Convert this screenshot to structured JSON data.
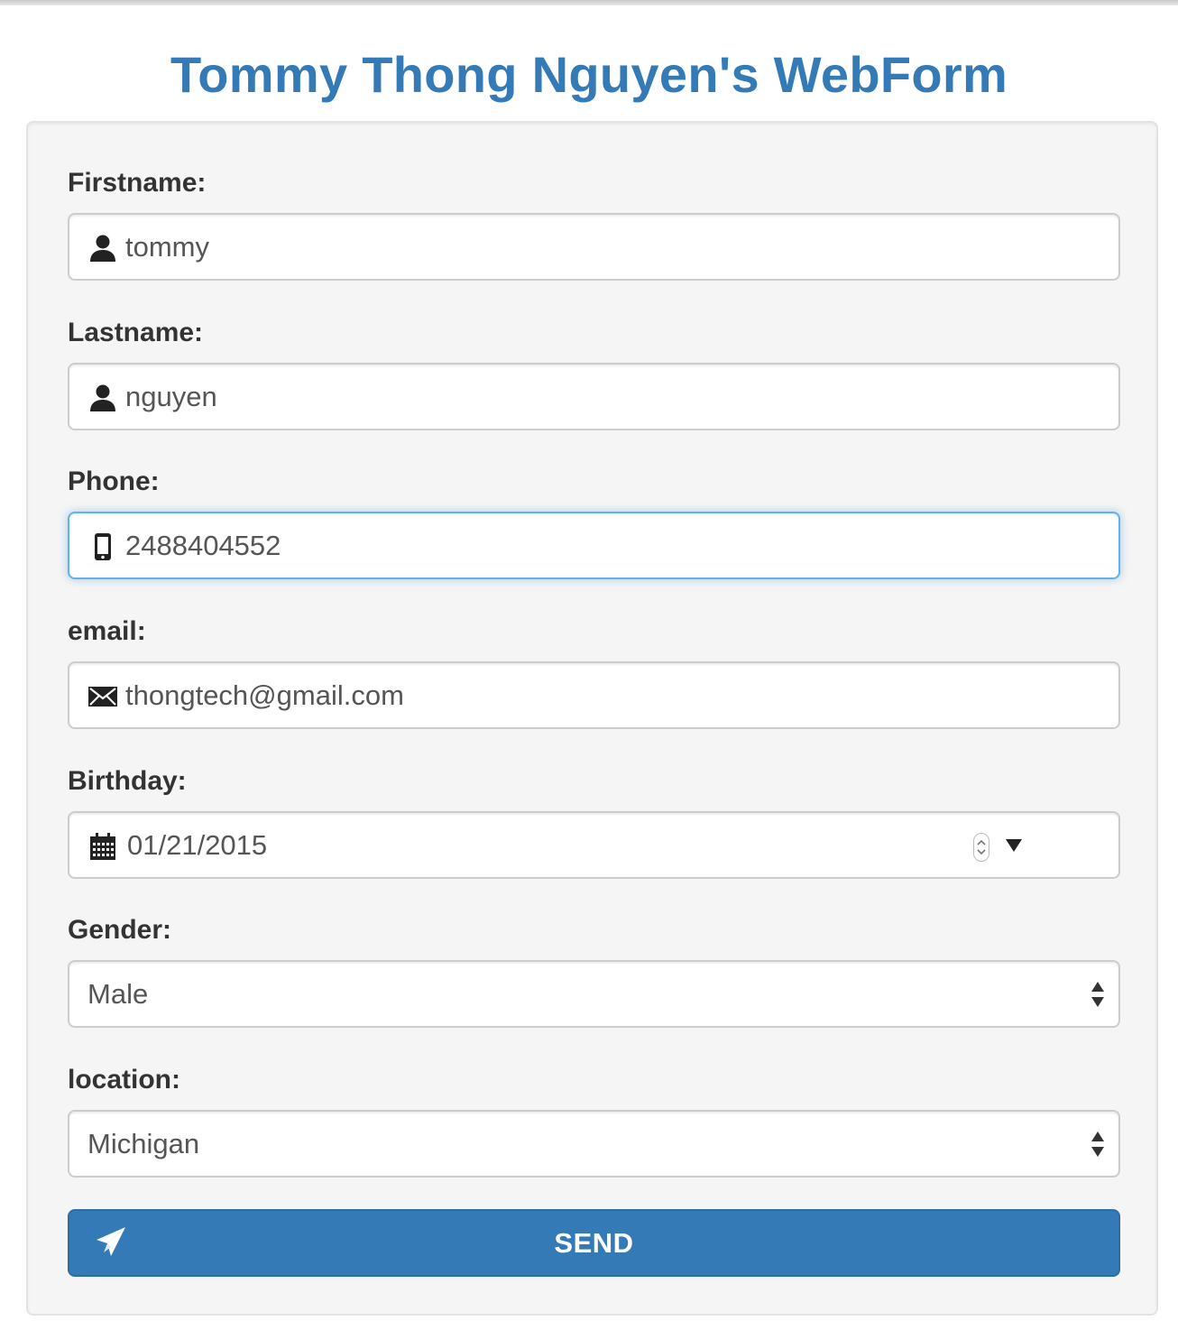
{
  "page": {
    "title": "Tommy Thong Nguyen's WebForm"
  },
  "colors": {
    "accent": "#337ab7",
    "panel_background": "#f5f5f5",
    "focus_border": "#66afe9"
  },
  "form": {
    "firstname": {
      "label": "Firstname:",
      "value": "tommy",
      "icon": "user-icon"
    },
    "lastname": {
      "label": "Lastname:",
      "value": "nguyen",
      "icon": "user-icon"
    },
    "phone": {
      "label": "Phone:",
      "value": "2488404552",
      "icon": "phone-icon",
      "focused": true
    },
    "email": {
      "label": "email:",
      "value": "thongtech@gmail.com",
      "icon": "envelope-icon"
    },
    "birthday": {
      "label": "Birthday:",
      "value": "01/21/2015",
      "icon": "calendar-icon"
    },
    "gender": {
      "label": "Gender:",
      "selected": "Male"
    },
    "location": {
      "label": "location:",
      "selected": "Michigan"
    },
    "submit": {
      "label": "SEND",
      "icon": "send-icon"
    }
  }
}
